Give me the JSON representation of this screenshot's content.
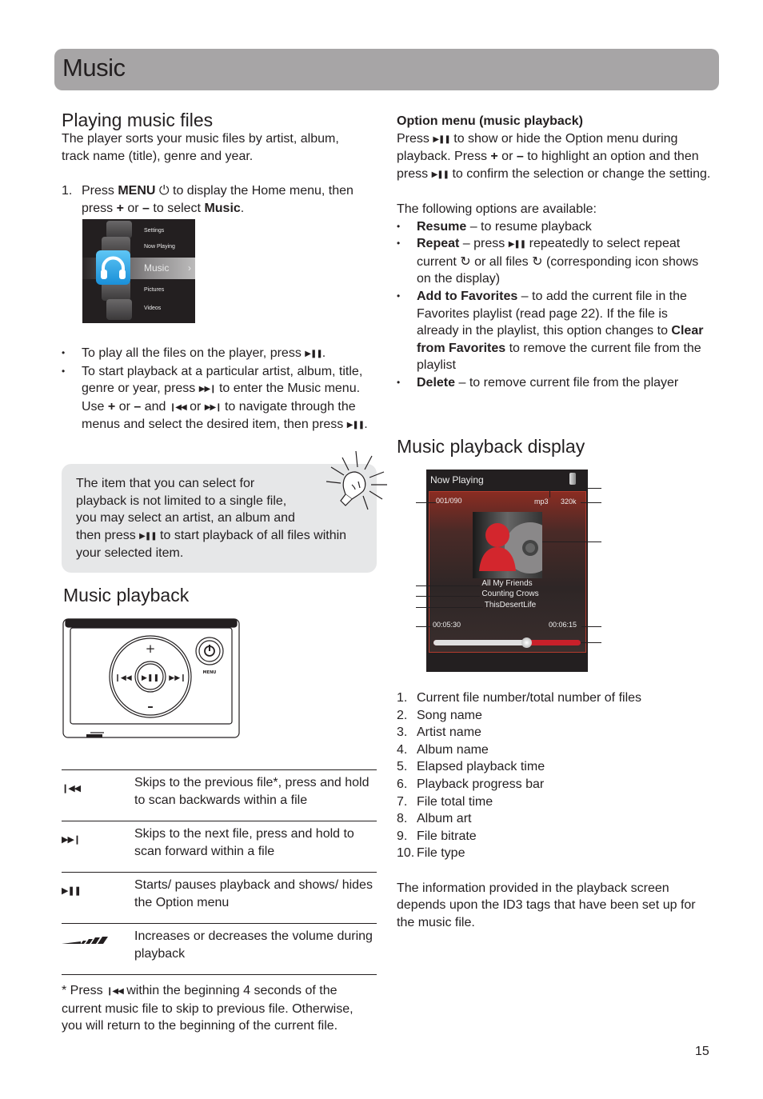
{
  "header": {
    "title": "Music"
  },
  "left": {
    "playing_title": "Playing music files",
    "intro": "The player sorts your music files by artist, album, track name (title), genre and year.",
    "step1": {
      "num": "1.",
      "pre": "Press ",
      "menu": "MENU",
      "mid": " to display the Home menu, then press ",
      "plus": "+",
      "or": " or ",
      "minus": "–",
      "post": " to select ",
      "music": "Music",
      "end": "."
    },
    "home_menu": {
      "items": [
        "Settings",
        "Now Playing",
        "Music",
        "Pictures",
        "Videos"
      ],
      "selected": "Music",
      "arrow": "›"
    },
    "bullets": [
      {
        "a": "To play all the files on the player, press ",
        "b": "."
      },
      {
        "a": "To start playback at a particular artist, album, title, genre or year, press ",
        "b": " to enter the Music menu. Use ",
        "c": "+",
        "d": " or ",
        "e": "–",
        "f": " and ",
        "g": " or ",
        "h": " to navigate through the menus and select the desired item, then press ",
        "i": "."
      }
    ],
    "tip": {
      "l1": "The item that you can select for",
      "l2": "playback is not limited to a single file,",
      "l3": "you may select an artist, an album and",
      "l4a": "then press ",
      "l4b": " to start playback of all files within",
      "l5": "your selected item."
    },
    "playback_title": "Music playback",
    "device": {
      "plus": "+",
      "minus": "–",
      "menu_label": "MENU"
    },
    "controls": [
      {
        "icon": "skip-back",
        "glyph": "⏮",
        "text": "Skips to the previous file*, press and hold to scan backwards within a file"
      },
      {
        "icon": "skip-forward",
        "glyph": "⏭",
        "text": "Skips to the next file, press and hold to scan forward within a file"
      },
      {
        "icon": "play-pause",
        "glyph": "⏯",
        "text": "Starts/ pauses playback and shows/ hides the Option menu"
      },
      {
        "icon": "volume",
        "glyph": "",
        "text": "Increases or decreases the volume during playback"
      }
    ],
    "footnote": {
      "a": "* Press ",
      "b": " within the beginning 4 seconds of the current music file to skip to previous file. Otherwise, you will return to the beginning of the current file."
    }
  },
  "right": {
    "option_title": "Option menu (music playback)",
    "option_p": {
      "a": "Press ",
      "b": " to show or hide the Option menu during playback. Press ",
      "c": "+",
      "d": " or ",
      "e": "–",
      "f": " to highlight an option and then press ",
      "g": " to confirm the selection or change the setting."
    },
    "following": "The following options are available:",
    "options": [
      {
        "name": "Resume",
        "text": " – to resume playback"
      },
      {
        "name": "Repeat",
        "text_a": " – press ",
        "text_b": " repeatedly to select repeat current ",
        "text_c": " or all files ",
        "text_d": "  (corresponding icon shows on the display)"
      },
      {
        "name": "Add to Favorites",
        "text_a": " – to add the current file in the Favorites playlist (read page 22). If the file is already in the playlist, this option changes to ",
        "bold2": "Clear from Favorites",
        "text_b": " to remove the current file from the playlist"
      },
      {
        "name": "Delete",
        "text": " – to remove current file from the player"
      }
    ],
    "display_title": "Music playback display",
    "screen": {
      "header": "Now Playing",
      "file_index": "001/090",
      "file_type": "mp3",
      "bitrate": "320k",
      "song": "All My Friends",
      "artist": "Counting Crows",
      "album": "ThisDesertLife",
      "elapsed": "00:05:30",
      "total": "00:06:15",
      "progress_fraction": 0.63,
      "accent_color": "#c8202a"
    },
    "legend": [
      {
        "n": "1.",
        "t": "Current file number/total number of files"
      },
      {
        "n": "2.",
        "t": "Song name"
      },
      {
        "n": "3.",
        "t": "Artist name"
      },
      {
        "n": "4.",
        "t": "Album name"
      },
      {
        "n": "5.",
        "t": "Elapsed playback time"
      },
      {
        "n": "6.",
        "t": "Playback progress bar"
      },
      {
        "n": "7.",
        "t": "File total time"
      },
      {
        "n": "8.",
        "t": "Album art"
      },
      {
        "n": "9.",
        "t": "File bitrate"
      },
      {
        "n": "10.",
        "t": "File type"
      }
    ],
    "info": "The information provided in the playback screen depends upon the ID3 tags that have been set up for the music file."
  },
  "page_number": "15"
}
